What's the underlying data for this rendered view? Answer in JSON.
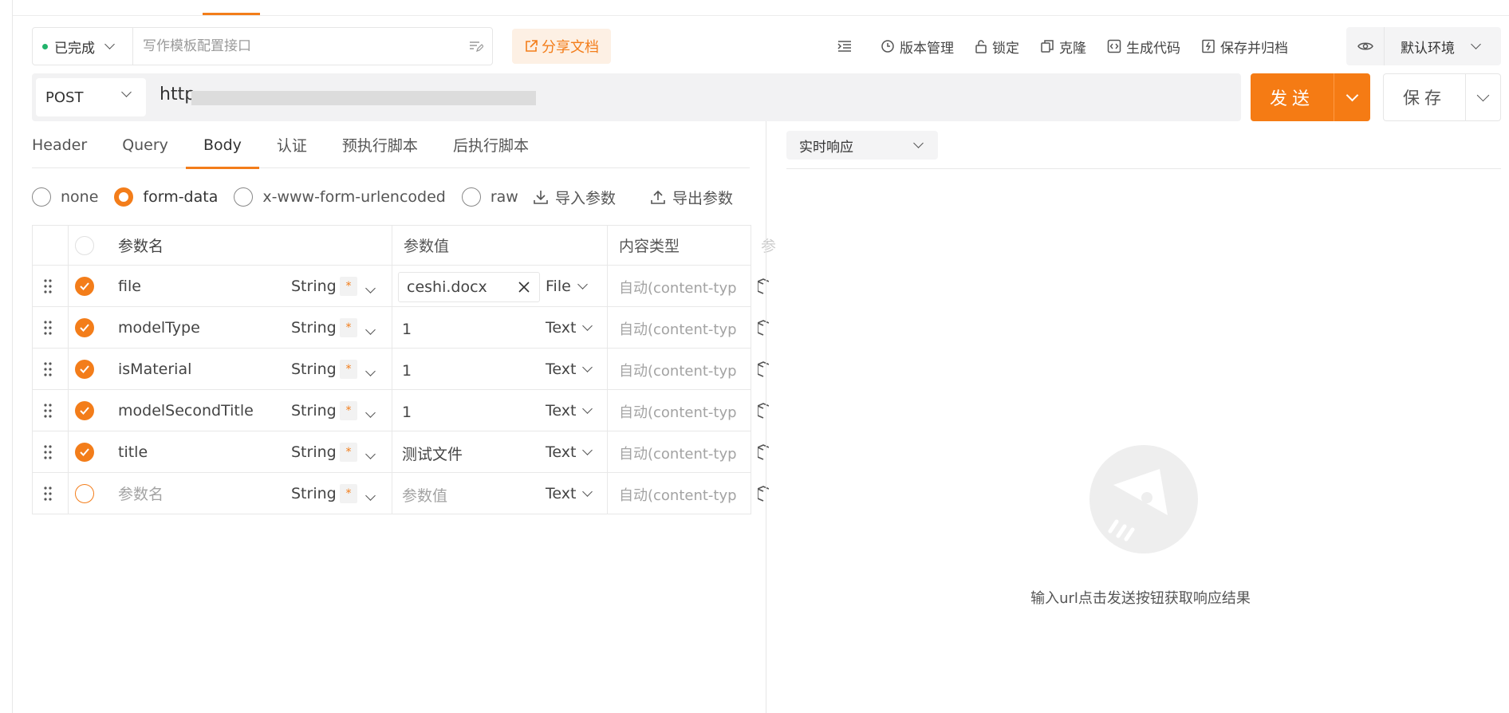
{
  "status": {
    "label": "已完成",
    "color": "#21b36b"
  },
  "title_input": {
    "value": "",
    "placeholder": "写作模板配置接口"
  },
  "share": {
    "label": "分享文档"
  },
  "toolbar": {
    "items": [
      {
        "label": "版本管理",
        "icon": "clock-icon"
      },
      {
        "label": "锁定",
        "icon": "lock-icon"
      },
      {
        "label": "克隆",
        "icon": "copy-icon"
      },
      {
        "label": "生成代码",
        "icon": "code-icon"
      },
      {
        "label": "保存并归档",
        "icon": "archive-icon"
      }
    ]
  },
  "environment": {
    "label": "默认环境"
  },
  "request": {
    "method": "POST",
    "url": "http"
  },
  "actions": {
    "send": "发送",
    "save": "保存"
  },
  "tabs": [
    {
      "label": "Header",
      "active": false
    },
    {
      "label": "Query",
      "active": false
    },
    {
      "label": "Body",
      "active": true
    },
    {
      "label": "认证",
      "active": false
    },
    {
      "label": "预执行脚本",
      "active": false
    },
    {
      "label": "后执行脚本",
      "active": false
    }
  ],
  "body_types": [
    {
      "label": "none",
      "selected": false
    },
    {
      "label": "form-data",
      "selected": true
    },
    {
      "label": "x-www-form-urlencoded",
      "selected": false
    },
    {
      "label": "raw",
      "selected": false
    }
  ],
  "import_label": "导入参数",
  "export_label": "导出参数",
  "table": {
    "headers": {
      "name": "参数名",
      "value": "参数值",
      "content_type": "内容类型",
      "extra": "参"
    },
    "rows": [
      {
        "checked": true,
        "name": "file",
        "type": "String",
        "required": "*",
        "value": "ceshi.docx",
        "value_type": "File",
        "content_type": "自动(content-typ",
        "is_file": true
      },
      {
        "checked": true,
        "name": "modelType",
        "type": "String",
        "required": "*",
        "value": "1",
        "value_type": "Text",
        "content_type": "自动(content-typ"
      },
      {
        "checked": true,
        "name": "isMaterial",
        "type": "String",
        "required": "*",
        "value": "1",
        "value_type": "Text",
        "content_type": "自动(content-typ"
      },
      {
        "checked": true,
        "name": "modelSecondTitle",
        "type": "String",
        "required": "*",
        "value": "1",
        "value_type": "Text",
        "content_type": "自动(content-typ"
      },
      {
        "checked": true,
        "name": "title",
        "type": "String",
        "required": "*",
        "value": "测试文件",
        "value_type": "Text",
        "content_type": "自动(content-typ"
      },
      {
        "checked": false,
        "name": "参数名",
        "type": "String",
        "required": "*",
        "value": "参数值",
        "value_type": "Text",
        "content_type": "自动(content-typ",
        "placeholder": true
      }
    ]
  },
  "response": {
    "mode": "实时响应",
    "empty_text": "输入url点击发送按钮获取响应结果"
  },
  "accent_color": "#f37d1a"
}
